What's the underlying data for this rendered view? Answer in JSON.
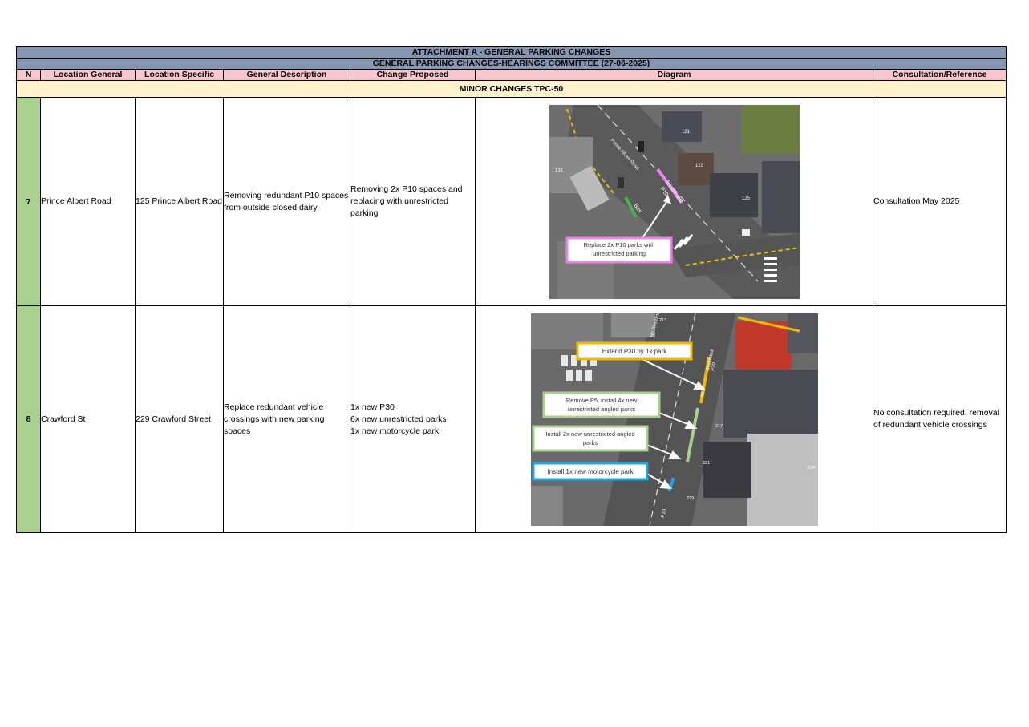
{
  "document": {
    "title": "ATTACHMENT A - GENERAL PARKING CHANGES",
    "subtitle": "GENERAL PARKING CHANGES-HEARINGS COMMITTEE (27-06-2025)"
  },
  "columns": {
    "n": "N",
    "location_general": "Location General",
    "location_specific": "Location Specific",
    "general_description": "General Description",
    "change_proposed": "Change Proposed",
    "diagram": "Diagram",
    "consultation": "Consultation/Reference"
  },
  "section": {
    "label": "MINOR CHANGES TPC-50"
  },
  "rows": [
    {
      "n": "7",
      "location_general": "Prince Albert Road",
      "location_specific": "125 Prince Albert Road",
      "general_description": "Removing redundant P10 spaces from outside closed dairy",
      "change_proposed": "Removing 2x P10 spaces and replacing with unrestricted parking",
      "consultation": "Consultation May 2025",
      "diagram": {
        "callouts": [
          {
            "line1": "Replace 2x P10 parks with",
            "line2": "unrestricted parking",
            "color": "#ee82ee"
          }
        ],
        "road_labels": [
          "Prince Albert Road",
          "Restricted",
          "P10",
          "Bus"
        ],
        "house_numbers": [
          "121",
          "123",
          "125",
          "131"
        ]
      }
    },
    {
      "n": "8",
      "location_general": "Crawford St",
      "location_specific": "229 Crawford Street",
      "general_description": "Replace redundant vehicle crossings with new parking spaces",
      "change_proposed": "1x new P30\n6x new unrestricted parks\n1x new motorcycle park",
      "consultation": "No consultation required, removal of redundant vehicle crossings",
      "diagram": {
        "callouts": [
          {
            "line1": "Extend P30 by 1x park",
            "line2": "",
            "color": "#f5b700"
          },
          {
            "line1": "Remove P5, install 4x new",
            "line2": "unrestricted angled parks",
            "color": "#a9d08e"
          },
          {
            "line1": "Install 2x new unrestricted angled",
            "line2": "parks",
            "color": "#a9d08e"
          },
          {
            "line1": "Install 1x new motorcycle park",
            "line2": "",
            "color": "#1ea6e0"
          }
        ],
        "road_labels": [
          "No Restricted",
          "Restricted",
          "P30",
          "P5",
          "P10"
        ],
        "house_numbers": [
          "213",
          "217",
          "221",
          "229",
          "234"
        ]
      }
    }
  ]
}
